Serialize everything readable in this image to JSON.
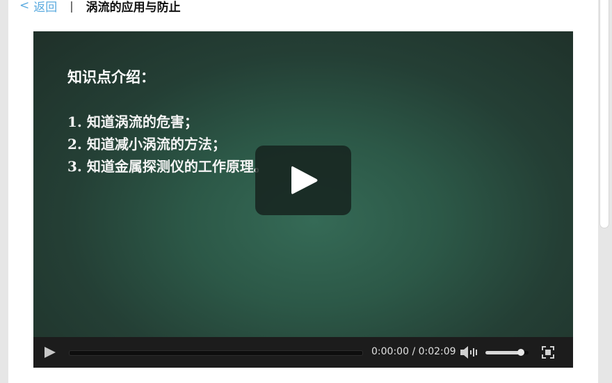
{
  "header": {
    "back_chevron": "<",
    "back_label": "返回",
    "separator": "|",
    "title": "涡流的应用与防止"
  },
  "video": {
    "slide_heading": "知识点介绍：",
    "slide_points": [
      "1. 知道涡流的危害；",
      "2. 知道减小涡流的方法；",
      "3. 知道金属探测仪的工作原理。"
    ],
    "current_time": "0:00:00",
    "time_separator": "/",
    "duration": "0:02:09",
    "progress_fraction": 0,
    "volume_fraction": 0.82
  },
  "colors": {
    "link": "#5aaadf",
    "board": "#2c5847",
    "controls_bg": "#1c1c1c"
  },
  "icons": {
    "big_play": "play-icon",
    "control_play": "play-icon",
    "volume": "speaker-icon",
    "fullscreen": "fullscreen-icon"
  }
}
